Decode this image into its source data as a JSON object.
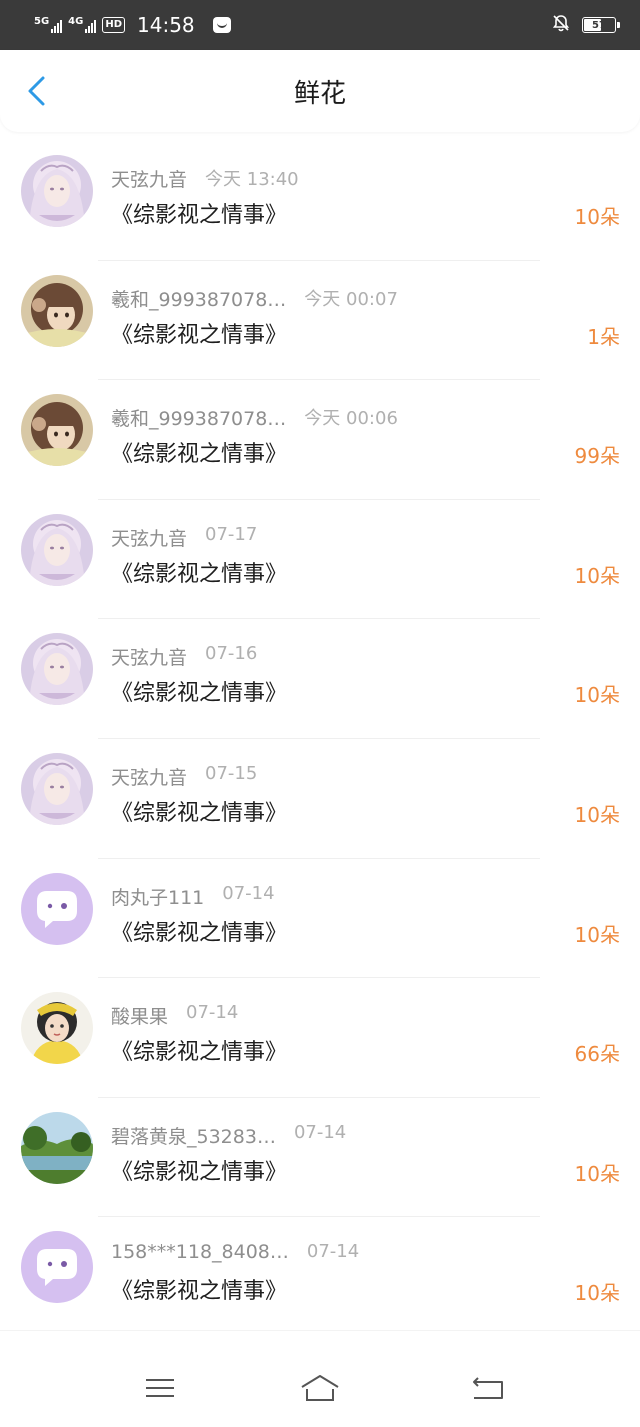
{
  "status_bar": {
    "net1": "5G",
    "net2": "4G",
    "hd": "HD",
    "time": "14:58",
    "battery": "57",
    "battery_level": 0.57
  },
  "header": {
    "title": "鲜花"
  },
  "items": [
    {
      "name": "天弦九音",
      "time": "今天 13:40",
      "book": "《综影视之情事》",
      "count": "10朵",
      "avatar": "avatar-anime-girl"
    },
    {
      "name": "羲和_999387078…",
      "time": "今天 00:07",
      "book": "《综影视之情事》",
      "count": "1朵",
      "avatar": "avatar-brown-hair-girl"
    },
    {
      "name": "羲和_999387078…",
      "time": "今天 00:06",
      "book": "《综影视之情事》",
      "count": "99朵",
      "avatar": "avatar-brown-hair-girl"
    },
    {
      "name": "天弦九音",
      "time": "07-17",
      "book": "《综影视之情事》",
      "count": "10朵",
      "avatar": "avatar-anime-girl"
    },
    {
      "name": "天弦九音",
      "time": "07-16",
      "book": "《综影视之情事》",
      "count": "10朵",
      "avatar": "avatar-anime-girl"
    },
    {
      "name": "天弦九音",
      "time": "07-15",
      "book": "《综影视之情事》",
      "count": "10朵",
      "avatar": "avatar-anime-girl"
    },
    {
      "name": "肉丸子111",
      "time": "07-14",
      "book": "《综影视之情事》",
      "count": "10朵",
      "avatar": "avatar-default-chat"
    },
    {
      "name": "酸果果",
      "time": "07-14",
      "book": "《综影视之情事》",
      "count": "66朵",
      "avatar": "avatar-yellow-outfit"
    },
    {
      "name": "碧落黄泉_53283…",
      "time": "07-14",
      "book": "《综影视之情事》",
      "count": "10朵",
      "avatar": "avatar-landscape"
    },
    {
      "name": "158***118_8408…",
      "time": "07-14",
      "book": "《综影视之情事》",
      "count": "10朵",
      "avatar": "avatar-default-chat"
    }
  ],
  "colors": {
    "accent_blue": "#2e9ae6",
    "count_orange": "#ee8a3e",
    "status_bar_bg": "#3a3a3a"
  },
  "nav": {
    "menu_icon": "menu-icon",
    "home_icon": "home-icon",
    "back_icon": "return-icon"
  }
}
